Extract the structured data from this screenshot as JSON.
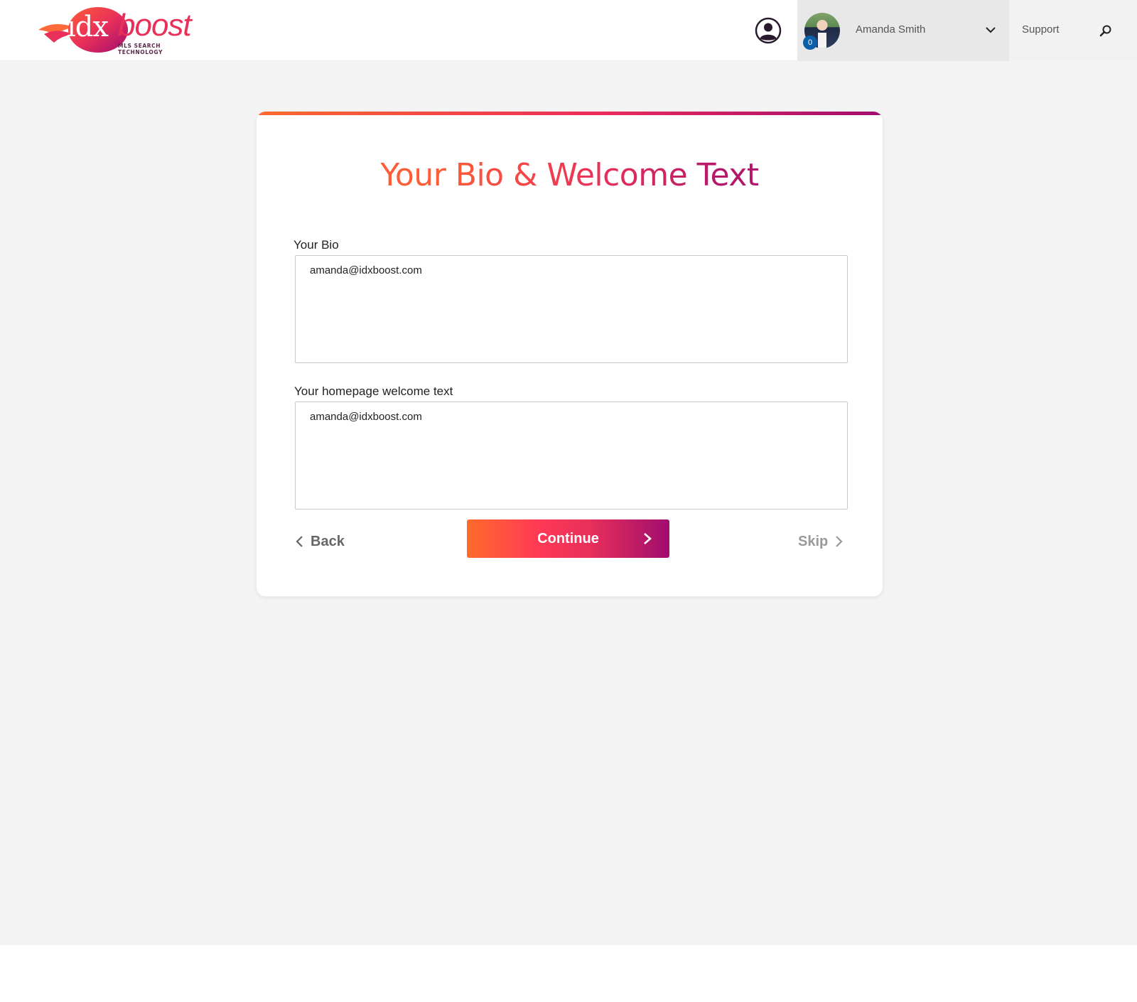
{
  "header": {
    "logo": {
      "idx": "idx",
      "boost": "boost",
      "tagline": "MLS SEARCH TECHNOLOGY",
      "brand_color": "#e8305a"
    },
    "account_icon": "user-circle-icon",
    "user": {
      "name": "Amanda Smith",
      "notification_count": "0"
    },
    "support_label": "Support",
    "search_icon": "search-icon"
  },
  "card": {
    "title": "Your Bio & Welcome Text",
    "bio": {
      "label": "Your Bio",
      "value": "amanda@idxboost.com"
    },
    "welcome": {
      "label": "Your homepage welcome text",
      "value": "amanda@idxboost.com"
    },
    "actions": {
      "back_label": "Back",
      "continue_label": "Continue",
      "skip_label": "Skip"
    },
    "accent_gradient": [
      "#ff6a2b",
      "#ea2b5c",
      "#a10d6e"
    ]
  }
}
